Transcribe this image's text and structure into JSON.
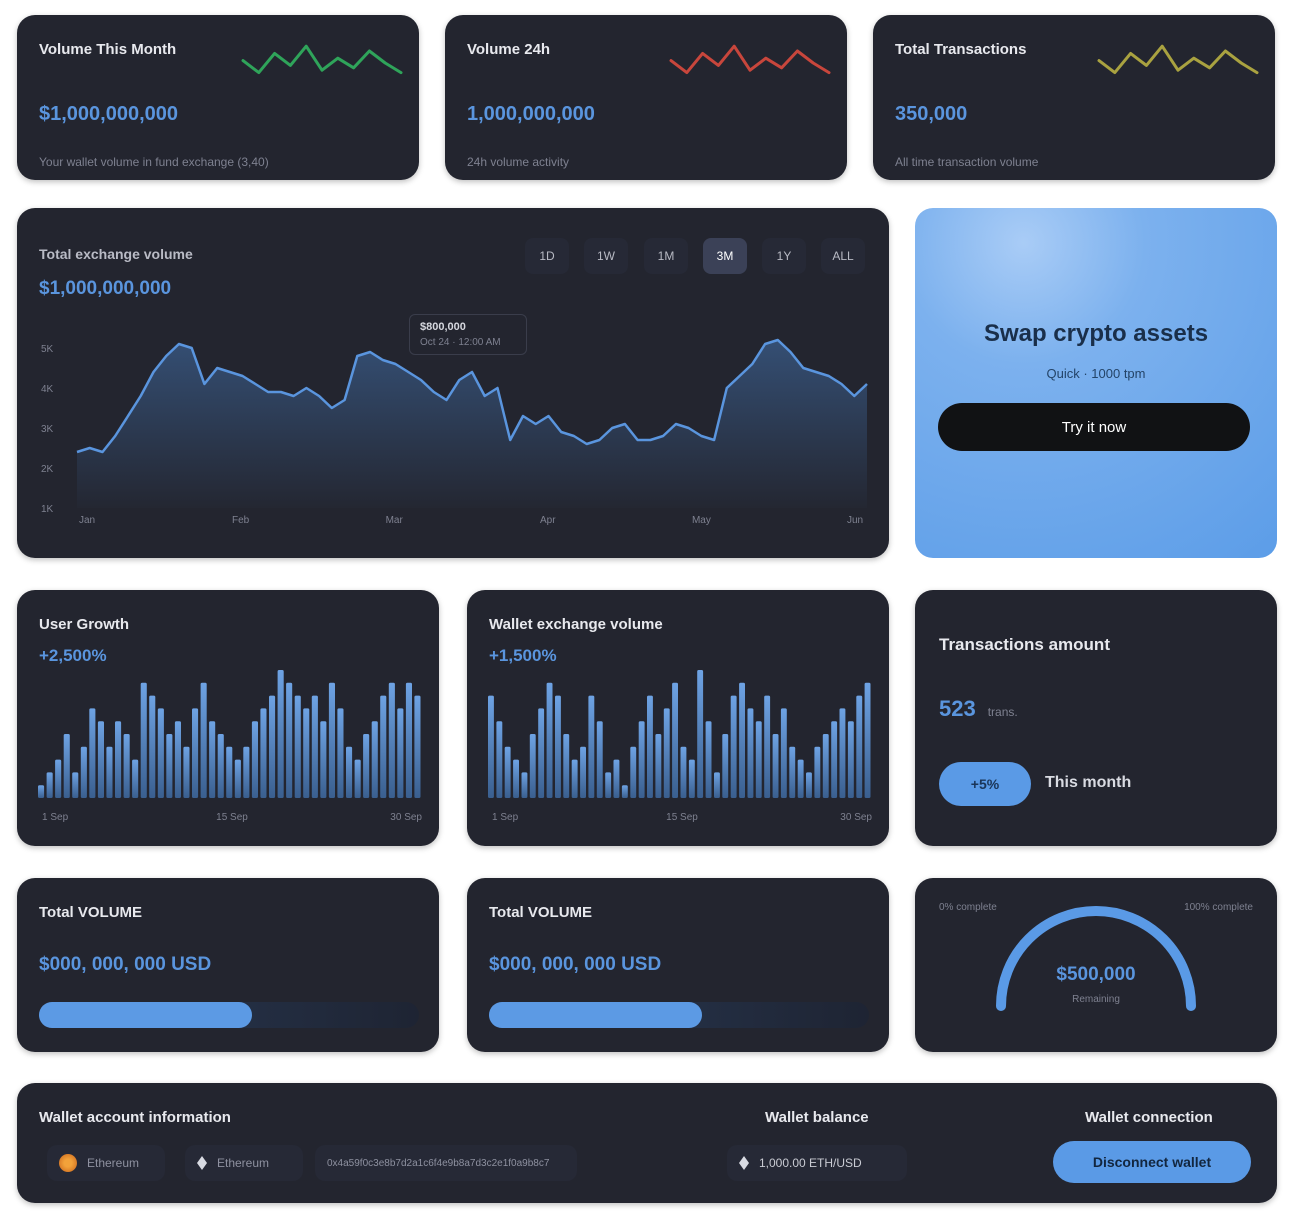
{
  "top_cards": [
    {
      "title": "Volume This Month",
      "value": "$1,000,000,000",
      "sub": "Your wallet volume in fund exchange (3,40)",
      "color": "#2fa45a",
      "trend": [
        0.55,
        0.3,
        0.7,
        0.45,
        0.85,
        0.35,
        0.6,
        0.4,
        0.75,
        0.5,
        0.3
      ]
    },
    {
      "title": "Volume 24h",
      "value": "1,000,000,000",
      "sub": "24h volume activity",
      "color": "#c8463c",
      "trend": [
        0.55,
        0.3,
        0.7,
        0.45,
        0.85,
        0.35,
        0.6,
        0.4,
        0.75,
        0.5,
        0.3
      ]
    },
    {
      "title": "Total Transactions",
      "value": "350,000",
      "sub": "All time transaction volume",
      "color": "#a9a240",
      "trend": [
        0.55,
        0.3,
        0.7,
        0.45,
        0.85,
        0.35,
        0.6,
        0.4,
        0.75,
        0.5,
        0.3
      ]
    }
  ],
  "main_chart": {
    "title": "Total exchange volume",
    "value": "$1,000,000,000",
    "timeframes": [
      "1D",
      "1W",
      "1M",
      "3M",
      "1Y",
      "ALL"
    ],
    "active_timeframe": "3M",
    "tooltip": {
      "line1": "$800,000",
      "line2": "Oct 24 · 12:00 AM"
    },
    "y_ticks": [
      "5K",
      "4K",
      "3K",
      "2K",
      "1K"
    ],
    "x_ticks": [
      "Jan",
      "Feb",
      "Mar",
      "Apr",
      "May",
      "Jun"
    ]
  },
  "chart_data": [
    {
      "type": "area",
      "title": "Total exchange volume",
      "y_ticks": [
        "1K",
        "2K",
        "3K",
        "4K",
        "5K"
      ],
      "ylim": [
        0.5,
        5
      ],
      "x": [
        "Jan",
        "Feb",
        "Mar",
        "Apr",
        "May",
        "Jun"
      ],
      "values": [
        1.9,
        2.0,
        1.9,
        2.3,
        2.8,
        3.3,
        3.9,
        4.3,
        4.6,
        4.5,
        3.6,
        4.0,
        3.9,
        3.8,
        3.6,
        3.4,
        3.4,
        3.3,
        3.5,
        3.3,
        3.0,
        3.2,
        4.3,
        4.4,
        4.2,
        4.1,
        3.9,
        3.7,
        3.4,
        3.2,
        3.7,
        3.9,
        3.3,
        3.5,
        2.2,
        2.8,
        2.6,
        2.8,
        2.4,
        2.3,
        2.1,
        2.2,
        2.5,
        2.6,
        2.2,
        2.2,
        2.3,
        2.6,
        2.5,
        2.3,
        2.2,
        3.5,
        3.8,
        4.1,
        4.6,
        4.7,
        4.4,
        4.0,
        3.9,
        3.8,
        3.6,
        3.3,
        3.6
      ]
    },
    {
      "type": "bar",
      "title": "User Growth",
      "x_labels": [
        "1 Sep",
        "15 Sep",
        "30 Sep"
      ],
      "values": [
        1,
        2,
        3,
        5,
        2,
        4,
        7,
        6,
        4,
        6,
        5,
        3,
        9,
        8,
        7,
        5,
        6,
        4,
        7,
        9,
        6,
        5,
        4,
        3,
        4,
        6,
        7,
        8,
        10,
        9,
        8,
        7,
        8,
        6,
        9,
        7,
        4,
        3,
        5,
        6,
        8,
        9,
        7,
        9,
        8
      ]
    },
    {
      "type": "bar",
      "title": "Wallet exchange volume",
      "x_labels": [
        "1 Sep",
        "15 Sep",
        "30 Sep"
      ],
      "values": [
        8,
        6,
        4,
        3,
        2,
        5,
        7,
        9,
        8,
        5,
        3,
        4,
        8,
        6,
        2,
        3,
        1,
        4,
        6,
        8,
        5,
        7,
        9,
        4,
        3,
        10,
        6,
        2,
        5,
        8,
        9,
        7,
        6,
        8,
        5,
        7,
        4,
        3,
        2,
        4,
        5,
        6,
        7,
        6,
        8,
        9
      ]
    }
  ],
  "user_growth": {
    "title": "User Growth",
    "value": "+2,500%",
    "x_labels": [
      "1 Sep",
      "15 Sep",
      "30 Sep"
    ]
  },
  "wallet_volume": {
    "title": "Wallet exchange volume",
    "value": "+1,500%",
    "x_labels": [
      "1 Sep",
      "15 Sep",
      "30 Sep"
    ]
  },
  "transactions": {
    "title": "Transactions amount",
    "count": "523",
    "count_unit": "trans.",
    "pill": "+5%",
    "pill_label": "This month"
  },
  "totals": [
    {
      "title": "Total VOLUME",
      "value": "$000, 000, 000 USD",
      "progress": 0.56
    },
    {
      "title": "Total VOLUME",
      "value": "$000, 000, 000 USD",
      "progress": 0.56
    }
  ],
  "gauge": {
    "left_label": "0% complete",
    "right_label": "100% complete",
    "value": "$500,000",
    "sub": "Remaining",
    "progress": 1.0
  },
  "swap": {
    "title": "Swap crypto assets",
    "sub": "Quick · 1000 tpm",
    "button": "Try it now"
  },
  "wallet": {
    "title": "Wallet account information",
    "chain": "Ethereum",
    "network": "Ethereum",
    "address": "0x4a59f0c3e8b7d2a1c6f4e9b8a7d3c2e1f0a9b8c7",
    "balance_title": "Wallet balance",
    "balance": "1,000.00 ETH/USD",
    "connection_title": "Wallet connection",
    "connect_button": "Disconnect wallet"
  }
}
